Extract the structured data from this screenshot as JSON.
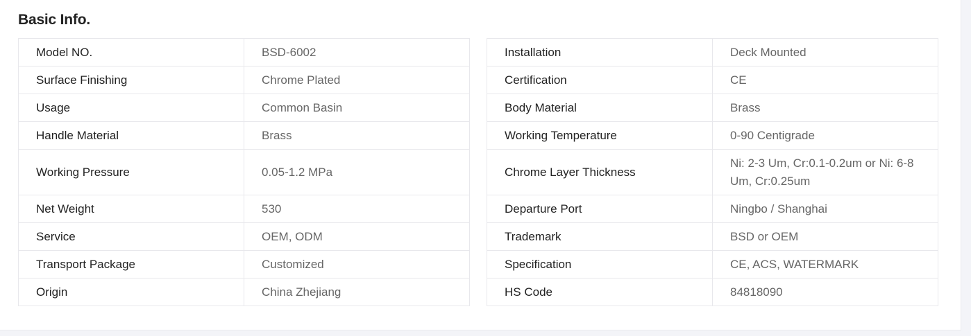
{
  "section": {
    "title": "Basic Info."
  },
  "left_table": {
    "rows": [
      {
        "label": "Model NO.",
        "value": "BSD-6002"
      },
      {
        "label": "Surface Finishing",
        "value": "Chrome Plated"
      },
      {
        "label": "Usage",
        "value": "Common Basin"
      },
      {
        "label": "Handle Material",
        "value": "Brass"
      },
      {
        "label": "Working Pressure",
        "value": "0.05-1.2 MPa"
      },
      {
        "label": "Net Weight",
        "value": "530"
      },
      {
        "label": "Service",
        "value": "OEM, ODM"
      },
      {
        "label": "Transport Package",
        "value": "Customized"
      },
      {
        "label": "Origin",
        "value": "China Zhejiang"
      }
    ]
  },
  "right_table": {
    "rows": [
      {
        "label": "Installation",
        "value": "Deck Mounted"
      },
      {
        "label": "Certification",
        "value": "CE"
      },
      {
        "label": "Body Material",
        "value": "Brass"
      },
      {
        "label": "Working Temperature",
        "value": "0-90 Centigrade"
      },
      {
        "label": "Chrome Layer Thickness",
        "value": "Ni: 2-3 Um, Cr:0.1-0.2um or Ni: 6-8 Um, Cr:0.25um"
      },
      {
        "label": "Departure Port",
        "value": "Ningbo / Shanghai"
      },
      {
        "label": "Trademark",
        "value": "BSD or OEM"
      },
      {
        "label": "Specification",
        "value": "CE, ACS, WATERMARK"
      },
      {
        "label": "HS Code",
        "value": "84818090"
      }
    ]
  }
}
